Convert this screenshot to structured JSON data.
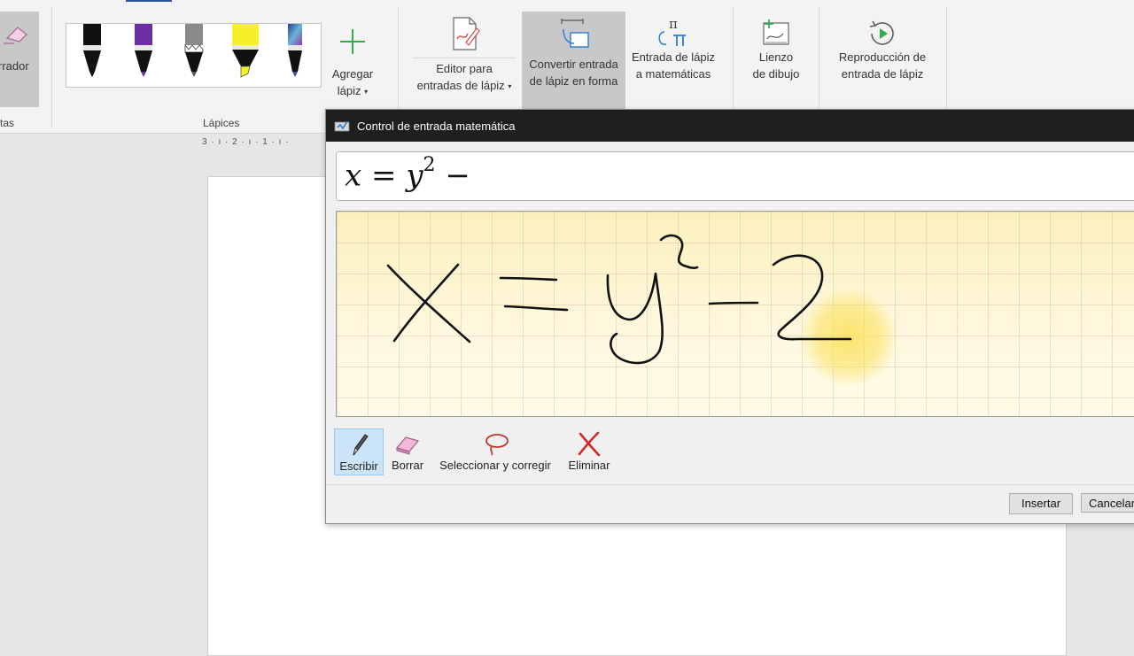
{
  "ribbon": {
    "eraser_label": "rrador",
    "notes_label": "tas",
    "pens_group_label": "Lápices",
    "add_pen_label_1": "Agregar",
    "add_pen_label_2": "lápiz",
    "ink_editor_label_1": "Editor para",
    "ink_editor_label_2": "entradas de lápiz",
    "ink_to_shape_label_1": "Convertir entrada",
    "ink_to_shape_label_2": "de lápiz en forma",
    "ink_to_math_label_1": "Entrada de lápiz",
    "ink_to_math_label_2": "a matemáticas",
    "canvas_label_1": "Lienzo",
    "canvas_label_2": "de dibujo",
    "replay_label_1": "Reproducción de",
    "replay_label_2": "entrada de lápiz",
    "pens": [
      {
        "name": "black-pen",
        "color": "#111111"
      },
      {
        "name": "purple-pen",
        "color": "#6b2fa3"
      },
      {
        "name": "gray-pencil",
        "color": "#8a8a8a"
      },
      {
        "name": "yellow-highlighter",
        "color": "#f7ef2a"
      },
      {
        "name": "galaxy-pen",
        "color": "#3a4fa8"
      }
    ]
  },
  "ruler": {
    "text": "3 · ı · 2 · ı · 1 · ı ·"
  },
  "dialog": {
    "title": "Control de entrada matemática",
    "preview": {
      "x": "x",
      "eq": "=",
      "y": "y",
      "exp": "2",
      "minus": "−"
    },
    "tools": {
      "write": "Escribir",
      "erase": "Borrar",
      "select_correct": "Seleccionar y corregir",
      "clear": "Eliminar"
    },
    "buttons": {
      "insert": "Insertar",
      "cancel": "Cancelar"
    }
  },
  "colors": {
    "titlebar": "#1f1f1f",
    "accent": "#2b579a",
    "active_tool": "#cce4f7"
  }
}
